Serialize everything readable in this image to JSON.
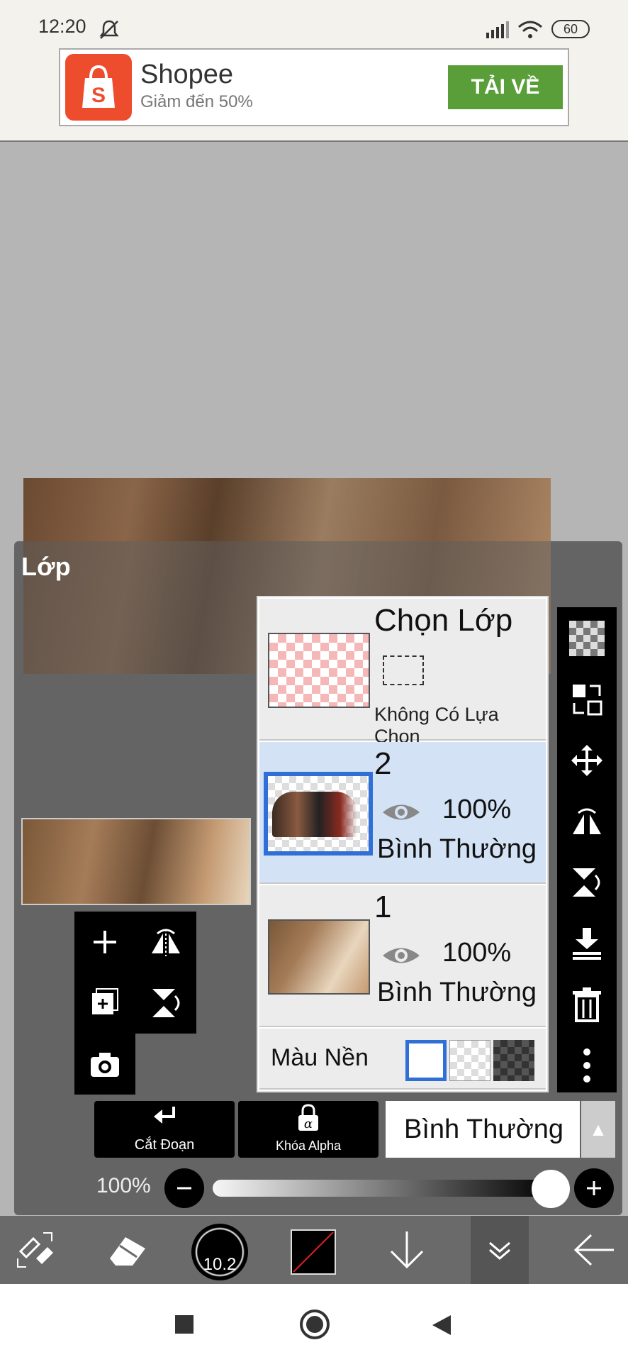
{
  "status_bar": {
    "time": "12:20",
    "battery": "60"
  },
  "ad": {
    "title": "Shopee",
    "subtitle": "Giảm đến 50%",
    "button": "TẢI VỀ"
  },
  "panel": {
    "title": "Lớp"
  },
  "layers": {
    "select": {
      "title": "Chọn Lớp",
      "subtitle": "Không Có Lựa Chọn"
    },
    "items": [
      {
        "name": "2",
        "opacity": "100%",
        "blend": "Bình Thường",
        "selected": true
      },
      {
        "name": "1",
        "opacity": "100%",
        "blend": "Bình Thường",
        "selected": false
      }
    ],
    "background": {
      "label": "Màu Nền"
    }
  },
  "controls": {
    "clip_label": "Cắt Đoạn",
    "alpha_label": "Khóa Alpha",
    "blend_mode": "Bình Thường",
    "opacity_label": "100%",
    "opacity_value": 1.0
  },
  "toolbar": {
    "brush_size": "10.2"
  },
  "icons": {
    "right": [
      "checker-icon",
      "transfer-icon",
      "move-icon",
      "flip-horizontal-icon",
      "flip-vertical-icon",
      "merge-down-icon",
      "trash-icon",
      "more-icon"
    ],
    "left": [
      "add-layer-icon",
      "flip-h-icon",
      "add-layer-copy-icon",
      "flip-v-icon",
      "camera-icon"
    ]
  },
  "colors": {
    "panel": "#5f5f5f",
    "selected_row": "#d3e2f5",
    "accent_blue": "#2f6fd6",
    "ad_button": "#5a9e3a",
    "shopee": "#ee4d2d"
  }
}
